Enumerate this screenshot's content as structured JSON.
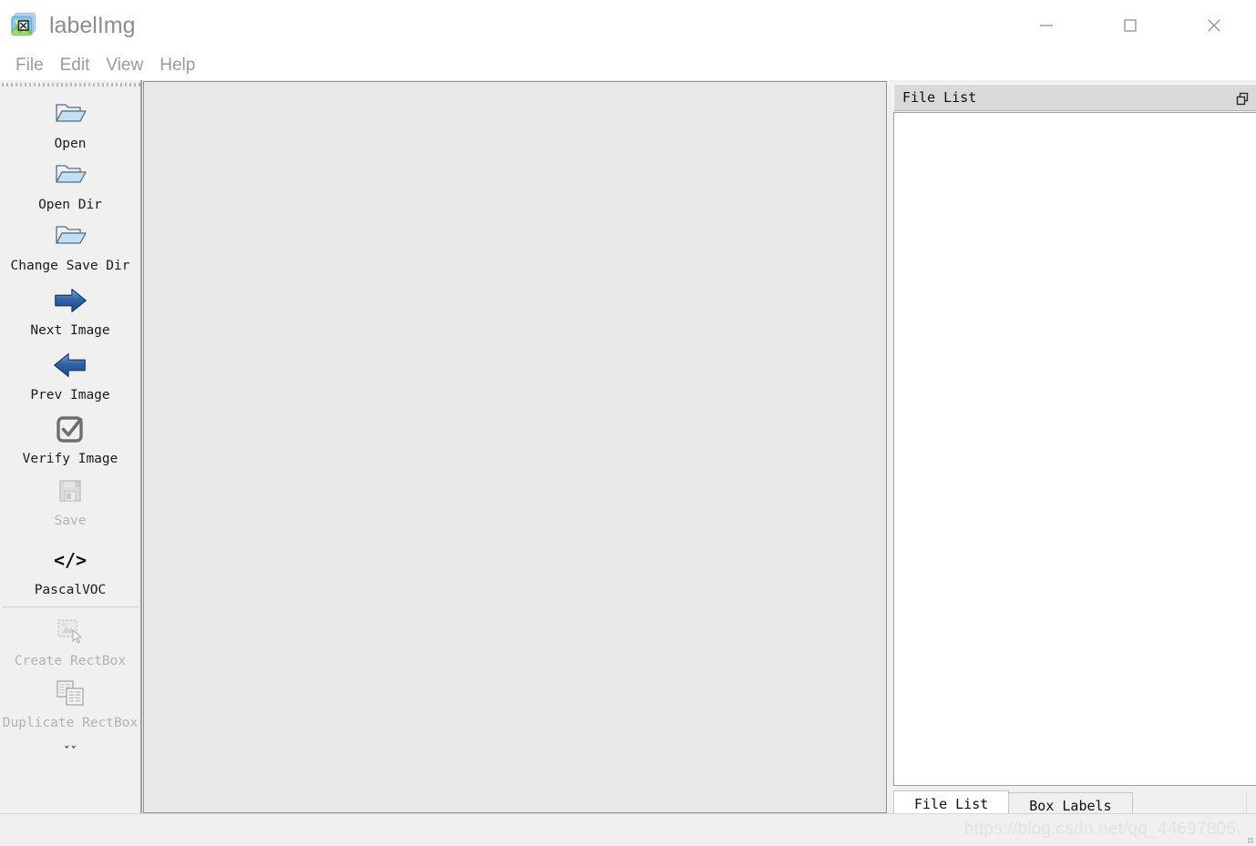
{
  "window": {
    "title": "labelImg",
    "app_icon": "labelimg-app-icon",
    "controls": {
      "minimize": "minimize-icon",
      "maximize": "maximize-icon",
      "close": "close-icon"
    }
  },
  "menubar": {
    "items": [
      {
        "label": "File"
      },
      {
        "label": "Edit"
      },
      {
        "label": "View"
      },
      {
        "label": "Help"
      }
    ]
  },
  "toolbar": {
    "items": [
      {
        "label": "Open",
        "icon": "open-folder-icon",
        "enabled": true
      },
      {
        "label": "Open Dir",
        "icon": "open-folder-icon",
        "enabled": true
      },
      {
        "label": "Change Save Dir",
        "icon": "open-folder-icon",
        "enabled": true
      },
      {
        "label": "Next Image",
        "icon": "arrow-right-icon",
        "enabled": true
      },
      {
        "label": "Prev Image",
        "icon": "arrow-left-icon",
        "enabled": true
      },
      {
        "label": "Verify Image",
        "icon": "checkbox-check-icon",
        "enabled": true
      },
      {
        "label": "Save",
        "icon": "floppy-disk-icon",
        "enabled": false
      },
      {
        "label": "PascalVOC",
        "icon": "code-brackets-icon",
        "enabled": true
      },
      {
        "label": "Create RectBox",
        "icon": "create-rectbox-icon",
        "enabled": false
      },
      {
        "label": "Duplicate RectBox",
        "icon": "duplicate-rectbox-icon",
        "enabled": false
      }
    ],
    "overflow_label": "ˇˇ",
    "drag_handle": "toolbar-drag-handle"
  },
  "canvas": {
    "name": "image-canvas",
    "background_color": "#e8e8e8",
    "border_color": "#8b919a"
  },
  "right_dock": {
    "title": "File List",
    "float_button_icon": "float-restore-icon",
    "list_items": [],
    "tabs": [
      {
        "label": "File List",
        "active": true
      },
      {
        "label": "Box Labels",
        "active": false
      }
    ]
  },
  "statusbar": {
    "watermark": "https://blog.csdn.net/qq_44697805",
    "size_grip": "resize-grip-icon"
  },
  "colors": {
    "titlebar_bg": "#ffffff",
    "menu_text": "#9a9a9a",
    "toolbar_bg": "#f0f0f0",
    "canvas_bg": "#e8e8e8",
    "dock_header_bg": "#d9d9d9",
    "disabled_text": "#b2b2b2",
    "accent_blue": "#3a6fb5"
  }
}
